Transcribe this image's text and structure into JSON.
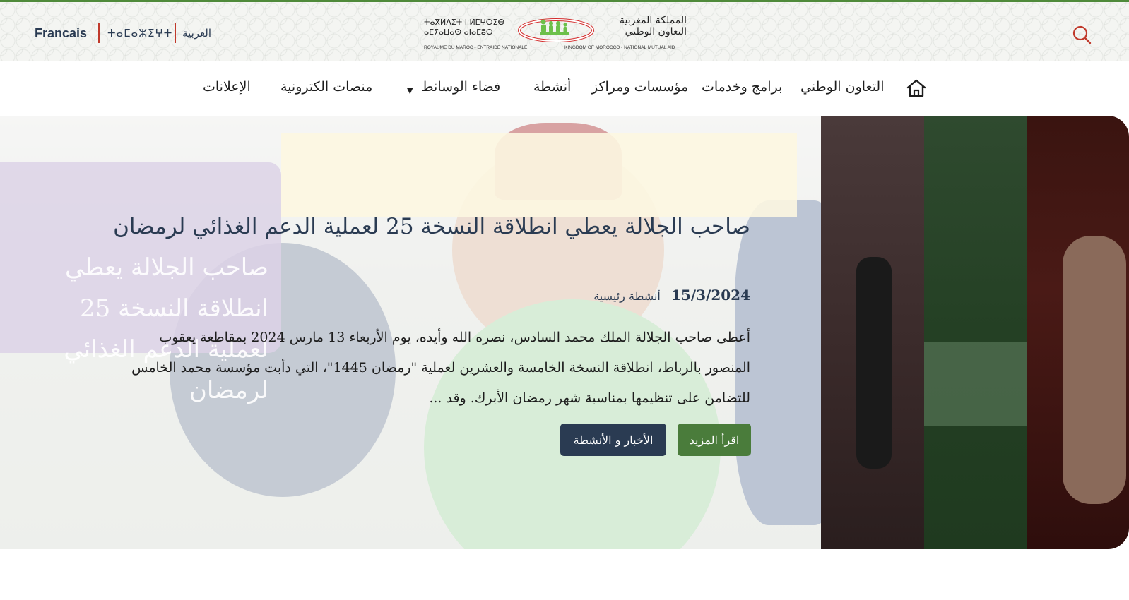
{
  "header": {
    "languages": {
      "french": "Francais",
      "tamazight": "ⵜⴰⵎⴰⵣⵉⵖⵜ",
      "arabic": "العربية"
    },
    "logo": {
      "tamazight_text": "ⵜⴰⴳⵍⴷⵉⵜ ⵏ ⵍⵎⵖⵔⵉⴱ ⴰⵎⵢⴰⵡⴰⵙ ⴰⵏⴰⵎⵓⵔ",
      "arabic_text": "المملكة المغربية التعاون الوطني",
      "french_caption": "ROYAUME DU MAROC - ENTRAIDE NATIONALE",
      "english_caption": "KINGDOM OF MOROCCO - NATIONAL MUTUAL AID",
      "icon": "people-ellipse-logo"
    },
    "search_icon": "search-icon"
  },
  "nav": {
    "home_icon": "home-icon",
    "items": [
      {
        "label": "التعاون الوطني"
      },
      {
        "label": "برامج وخدمات"
      },
      {
        "label": "مؤسسات ومراكز"
      },
      {
        "label": "أنشطة"
      },
      {
        "label": "فضاء الوسائط",
        "has_dropdown": true
      },
      {
        "label": "منصات الكترونية"
      },
      {
        "label": "الإعلانات"
      }
    ],
    "dropdown_icon": "caret-down-icon"
  },
  "hero": {
    "background_sign_text": "صاحب الجلالة يعطي انطلاقة النسخة 25 لعملية الدعم الغذائي لرمضان",
    "headline": "صاحب الجلالة يعطي انطلاقة النسخة 25 لعملية الدعم الغذائي لرمضان",
    "date": "15/3/2024",
    "category": "أنشطة رئيسية",
    "excerpt": "أعطى صاحب الجلالة الملك محمد السادس، نصره الله وأيده، يوم الأربعاء 13 مارس 2024 بمقاطعة يعقوب المنصور بالرباط، انطلاقة النسخة الخامسة والعشرين لعملية \"رمضان 1445\"، التي دأبت مؤسسة محمد الخامس للتضامن على تنظيمها بمناسبة شهر رمضان الأبرك. وقد ...",
    "read_more_label": "اقرأ المزيد",
    "news_label": "الأخبار و الأنشطة"
  },
  "colors": {
    "primary_navy": "#2a3b52",
    "accent_green": "#4a7c3b",
    "accent_red": "#c0392b"
  }
}
